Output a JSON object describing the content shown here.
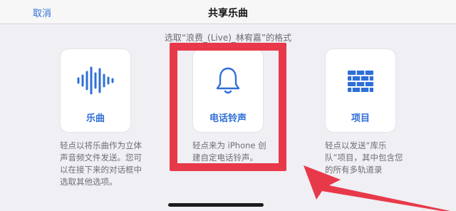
{
  "nav": {
    "cancel_label": "取消",
    "title": "共享乐曲"
  },
  "subtitle": "选取“浪费_(Live)_林宥嘉”的格式",
  "options": [
    {
      "label": "乐曲",
      "icon": "waveform-icon",
      "description": "轻点以将乐曲作为立体声音频文件发送。您可以在接下来的对话框中选取其他选项。"
    },
    {
      "label": "电话铃声",
      "icon": "bell-icon",
      "description": "轻点来为 iPhone 创建自定电话铃声。"
    },
    {
      "label": "项目",
      "icon": "brick-wall-icon",
      "description": "轻点以发送“库乐队”项目，其中包含您的所有多轨道录"
    }
  ],
  "colors": {
    "accent": "#2f6fd6",
    "annotation": "#e8394a",
    "background": "#efeff4"
  }
}
